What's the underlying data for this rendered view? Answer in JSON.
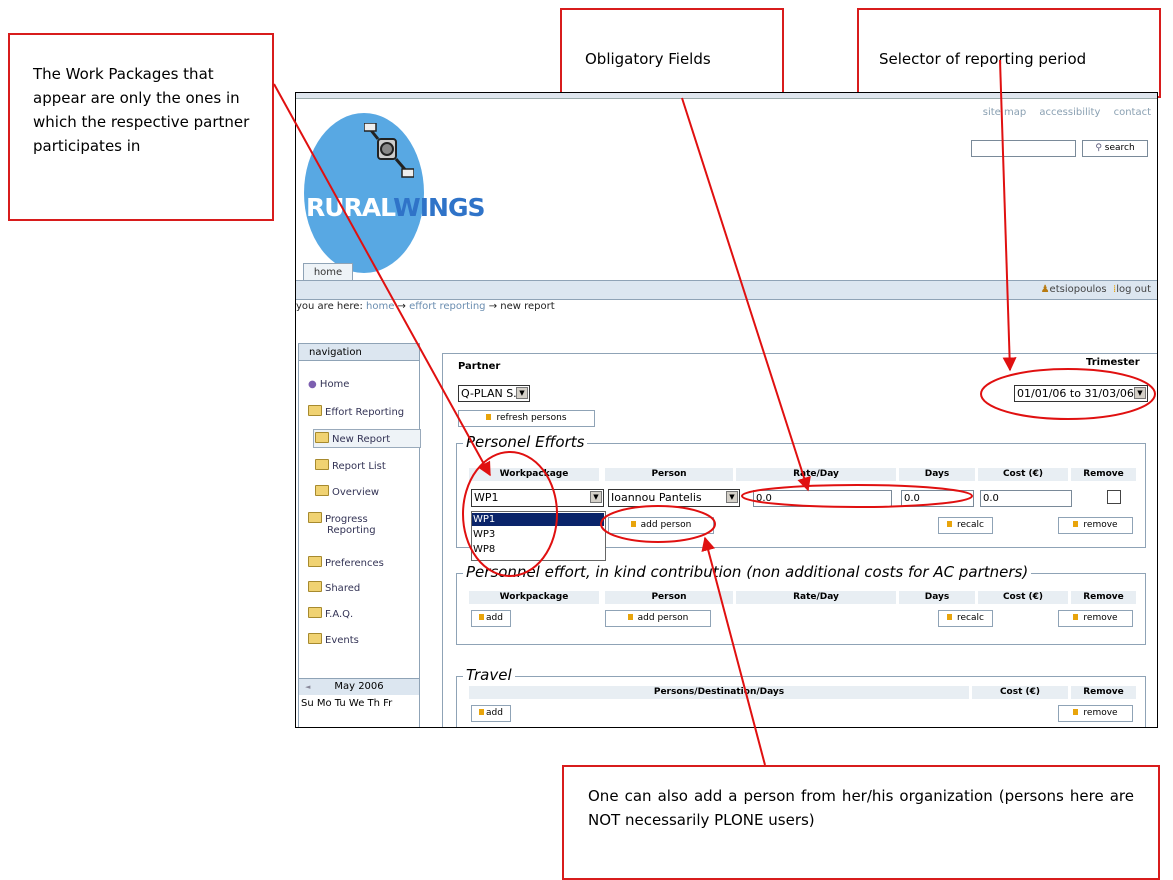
{
  "callouts": {
    "work_packages": "The Work Packages that appear are only the ones in which the respective partner participates in",
    "obligatory": "Obligatory Fields",
    "selector": "Selector of reporting period",
    "add_person": "One can also add a person from her/his organization (persons here are NOT necessarily PLONE users)"
  },
  "site_actions": [
    "site map",
    "accessibility",
    "contact"
  ],
  "search": {
    "button": "search",
    "value": ""
  },
  "logo": {
    "part1": "RURAL",
    "part2": "WINGS"
  },
  "tabs": {
    "home": "home"
  },
  "user": {
    "name": "etsiopoulos",
    "logout": "log out"
  },
  "breadcrumb": {
    "prefix": "you are here:",
    "home": "home",
    "arrow1": "→",
    "effort": "effort reporting",
    "arrow2": "→",
    "current": "new report"
  },
  "nav": {
    "title": "navigation",
    "items": [
      "Home",
      "Effort Reporting",
      "New Report",
      "Report List",
      "Overview",
      "Progress",
      "Reporting",
      "Preferences",
      "Shared",
      "F.A.Q.",
      "Events"
    ]
  },
  "calendar": {
    "prev": "◄",
    "month": "May 2006",
    "days": "Su Mo Tu We Th  Fr"
  },
  "form": {
    "partner_label": "Partner",
    "partner_value": "Q-PLAN S.A.",
    "refresh_button": "refresh persons",
    "trimester_label": "Trimester",
    "trimester_value": "01/01/06 to 31/03/06"
  },
  "personnel": {
    "legend": "Personel Efforts",
    "headers": [
      "Workpackage",
      "Person",
      "Rate/Day",
      "Days",
      "Cost (€)",
      "Remove"
    ],
    "workpackage": "WP1",
    "person": "Ioannou Pantelis",
    "rate": "0.0",
    "days": "0.0",
    "cost": "0.0",
    "dropdown_options": [
      "WP1",
      "WP3",
      "WP8"
    ],
    "add_person": "add person",
    "recalc": "recalc",
    "remove": "remove"
  },
  "inkind": {
    "legend": "Personnel effort, in kind contribution (non additional costs for AC partners)",
    "headers": [
      "Workpackage",
      "Person",
      "Rate/Day",
      "Days",
      "Cost (€)",
      "Remove"
    ],
    "add": "add",
    "add_person": "add person",
    "recalc": "recalc",
    "remove": "remove"
  },
  "travel": {
    "legend": "Travel",
    "headers": [
      "Persons/Destination/Days",
      "Cost (€)",
      "Remove"
    ],
    "add": "add",
    "remove": "remove"
  },
  "colors": {
    "annotation": "#e01010",
    "logo_blue": "#58a8e3",
    "selected": "#0a246a"
  }
}
